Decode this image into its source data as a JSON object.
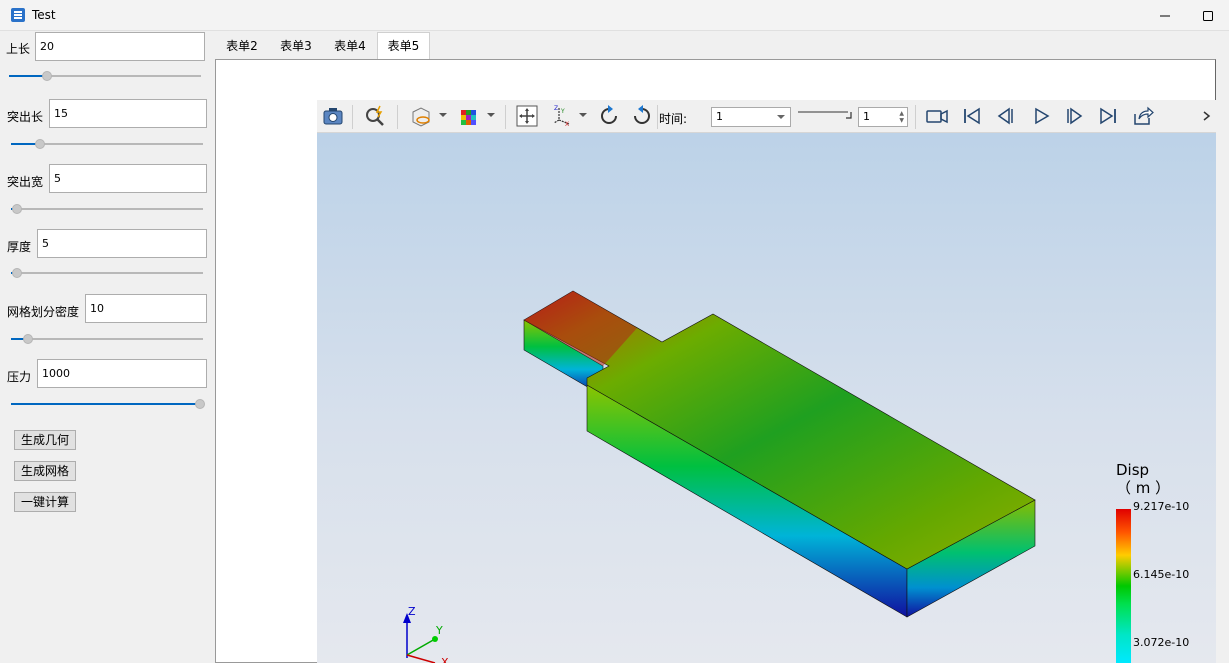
{
  "window": {
    "title": "Test",
    "minimize_glyph": "—",
    "maximize_glyph": "☐"
  },
  "params": [
    {
      "label": "上长",
      "value": "20",
      "slider_fraction": 0.2
    },
    {
      "label": "突出长",
      "value": "15",
      "slider_fraction": 0.15
    },
    {
      "label": "突出宽",
      "value": "5",
      "slider_fraction": 0.03
    },
    {
      "label": "厚度",
      "value": "5",
      "slider_fraction": 0.03
    },
    {
      "label": "网格划分密度",
      "value": "10",
      "slider_fraction": 0.09
    },
    {
      "label": "压力",
      "value": "1000",
      "slider_fraction": 1.0
    }
  ],
  "buttons": {
    "generate_geometry": "生成几何",
    "generate_mesh": "生成网格",
    "one_click_compute": "一键计算"
  },
  "tabs": [
    "表单2",
    "表单3",
    "表单4",
    "表单5"
  ],
  "active_tab": "表单5",
  "toolbar": {
    "time_label": "时间:",
    "time_value": "1",
    "time_step_value": "1"
  },
  "legend": {
    "title_line1": "Disp",
    "title_line2": "（ m ）",
    "ticks": [
      "9.217e-10",
      "6.145e-10",
      "3.072e-10"
    ],
    "colors": {
      "max": "#e00000",
      "mid": "#00c800",
      "min": "#00e8ff"
    }
  },
  "axes": {
    "z": "Z",
    "y": "Y",
    "x": "X"
  },
  "colors": {
    "accent": "#0067c0"
  }
}
